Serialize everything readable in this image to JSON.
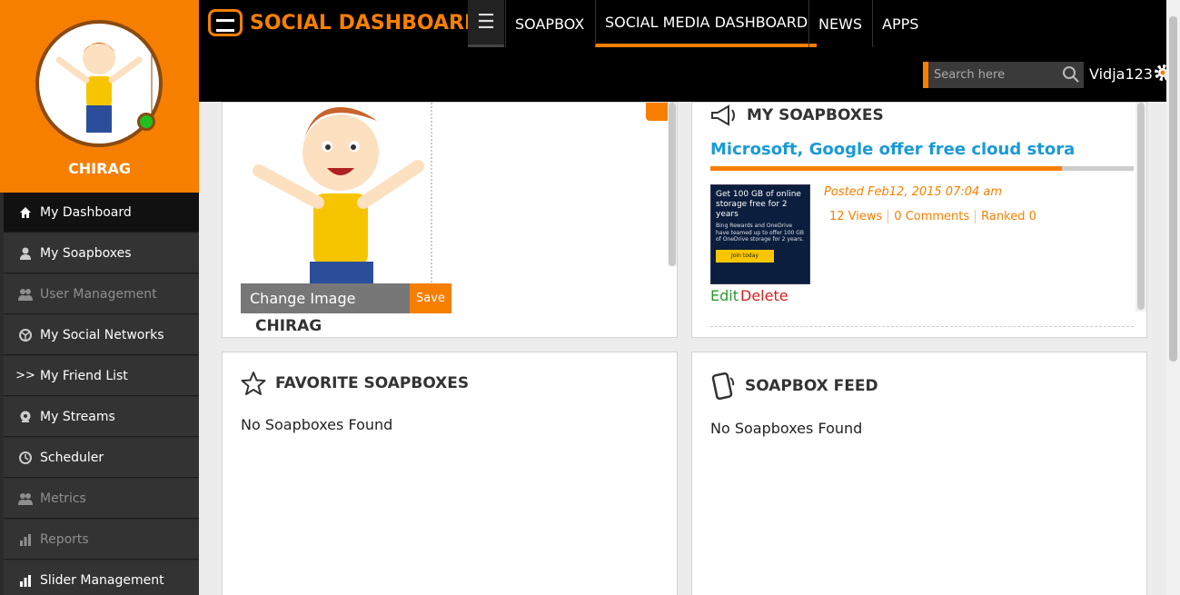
{
  "sidebar": {
    "profile_name": "CHIRAG",
    "items": [
      {
        "label": "My Dashboard",
        "icon": "home-icon"
      },
      {
        "label": "My Soapboxes",
        "icon": "user-icon"
      },
      {
        "label": "User Management",
        "icon": "users-icon"
      },
      {
        "label": "My Social Networks",
        "icon": "globe-icon"
      },
      {
        "label": "My Friend List",
        "icon": "arrows-icon",
        "prefix": ">>"
      },
      {
        "label": "My Streams",
        "icon": "stream-icon"
      },
      {
        "label": "Scheduler",
        "icon": "clock-icon"
      },
      {
        "label": "Metrics",
        "icon": "users-icon"
      },
      {
        "label": "Reports",
        "icon": "bar-chart-icon"
      },
      {
        "label": "Slider Management",
        "icon": "bar-chart-icon"
      }
    ]
  },
  "header": {
    "logo_text": "SOCIAL DASHBOARD",
    "nav": [
      "SOAPBOX",
      "SOCIAL MEDIA DASHBOARD",
      "NEWS",
      "APPS"
    ],
    "search_placeholder": "Search here",
    "username": "Vidja123"
  },
  "profile_panel": {
    "change_image_label": "Change Image",
    "save_label": "Save",
    "caption": "CHIRAG"
  },
  "soapboxes_panel": {
    "title": "MY SOAPBOXES",
    "post_title": "Microsoft, Google offer free cloud storage p",
    "posted": "Posted Feb12, 2015 07:04 am",
    "views": "12 Views",
    "comments": "0 Comments",
    "ranked": "Ranked 0",
    "edit_label": "Edit",
    "delete_label": "Delete",
    "progress_fraction": 0.83,
    "thumb_title": "Get 100 GB of online storage free for 2 years",
    "thumb_body": "Bing Rewards and OneDrive have teamed up to offer 100 GB of OneDrive storage for 2 years.",
    "thumb_button": "Join today"
  },
  "favorites_panel": {
    "title": "FAVORITE SOAPBOXES",
    "empty": "No Soapboxes Found"
  },
  "feed_panel": {
    "title": "SOAPBOX FEED",
    "empty": "No Soapboxes Found"
  },
  "colors": {
    "accent": "#f77f00",
    "link": "#1a9ad6",
    "edit": "#2a9a2a",
    "delete": "#d42020"
  }
}
